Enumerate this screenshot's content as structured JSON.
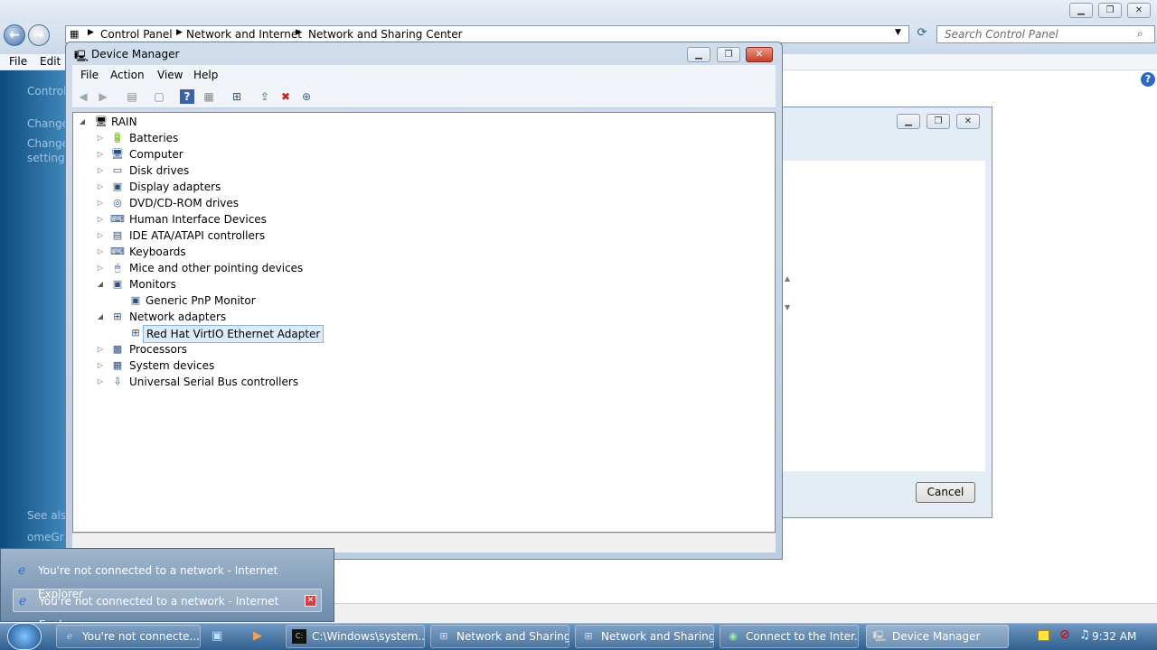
{
  "control_panel": {
    "breadcrumb": [
      "Control Panel",
      "Network and Internet",
      "Network and Sharing Center"
    ],
    "search_placeholder": "Search Control Panel",
    "menu": [
      "File",
      "Edit"
    ],
    "left_links": [
      "Control",
      "Change",
      "Change",
      "settings"
    ],
    "see_also": "See also",
    "homegroup": "omeGr"
  },
  "connect_dialog": {
    "cancel_label": "Cancel"
  },
  "device_manager": {
    "title": "Device Manager",
    "menu": [
      "File",
      "Action",
      "View",
      "Help"
    ],
    "root": "RAIN",
    "items": [
      {
        "label": "Batteries",
        "icon": "battery-icon"
      },
      {
        "label": "Computer",
        "icon": "computer-icon"
      },
      {
        "label": "Disk drives",
        "icon": "disk-icon"
      },
      {
        "label": "Display adapters",
        "icon": "display-icon"
      },
      {
        "label": "DVD/CD-ROM drives",
        "icon": "dvd-icon"
      },
      {
        "label": "Human Interface Devices",
        "icon": "hid-icon"
      },
      {
        "label": "IDE ATA/ATAPI controllers",
        "icon": "ide-icon"
      },
      {
        "label": "Keyboards",
        "icon": "keyboard-icon"
      },
      {
        "label": "Mice and other pointing devices",
        "icon": "mouse-icon"
      },
      {
        "label": "Monitors",
        "icon": "monitor-icon"
      },
      {
        "label": "Generic PnP Monitor",
        "icon": "monitor-icon"
      },
      {
        "label": "Network adapters",
        "icon": "network-icon"
      },
      {
        "label": "Red Hat VirtIO Ethernet Adapter",
        "icon": "network-icon"
      },
      {
        "label": "Processors",
        "icon": "processor-icon"
      },
      {
        "label": "System devices",
        "icon": "system-icon"
      },
      {
        "label": "Universal Serial Bus controllers",
        "icon": "usb-icon"
      }
    ]
  },
  "popup": {
    "items": [
      "You're not connected to a network - Internet Explorer",
      "You're not connected to a network - Internet Explorer"
    ]
  },
  "taskbar": {
    "buttons": [
      "You're not connecte...",
      "C:\\Windows\\system...",
      "Network and Sharing...",
      "Network and Sharing...",
      "Connect to the Inter...",
      "Device Manager"
    ],
    "clock": "9:32 AM"
  }
}
